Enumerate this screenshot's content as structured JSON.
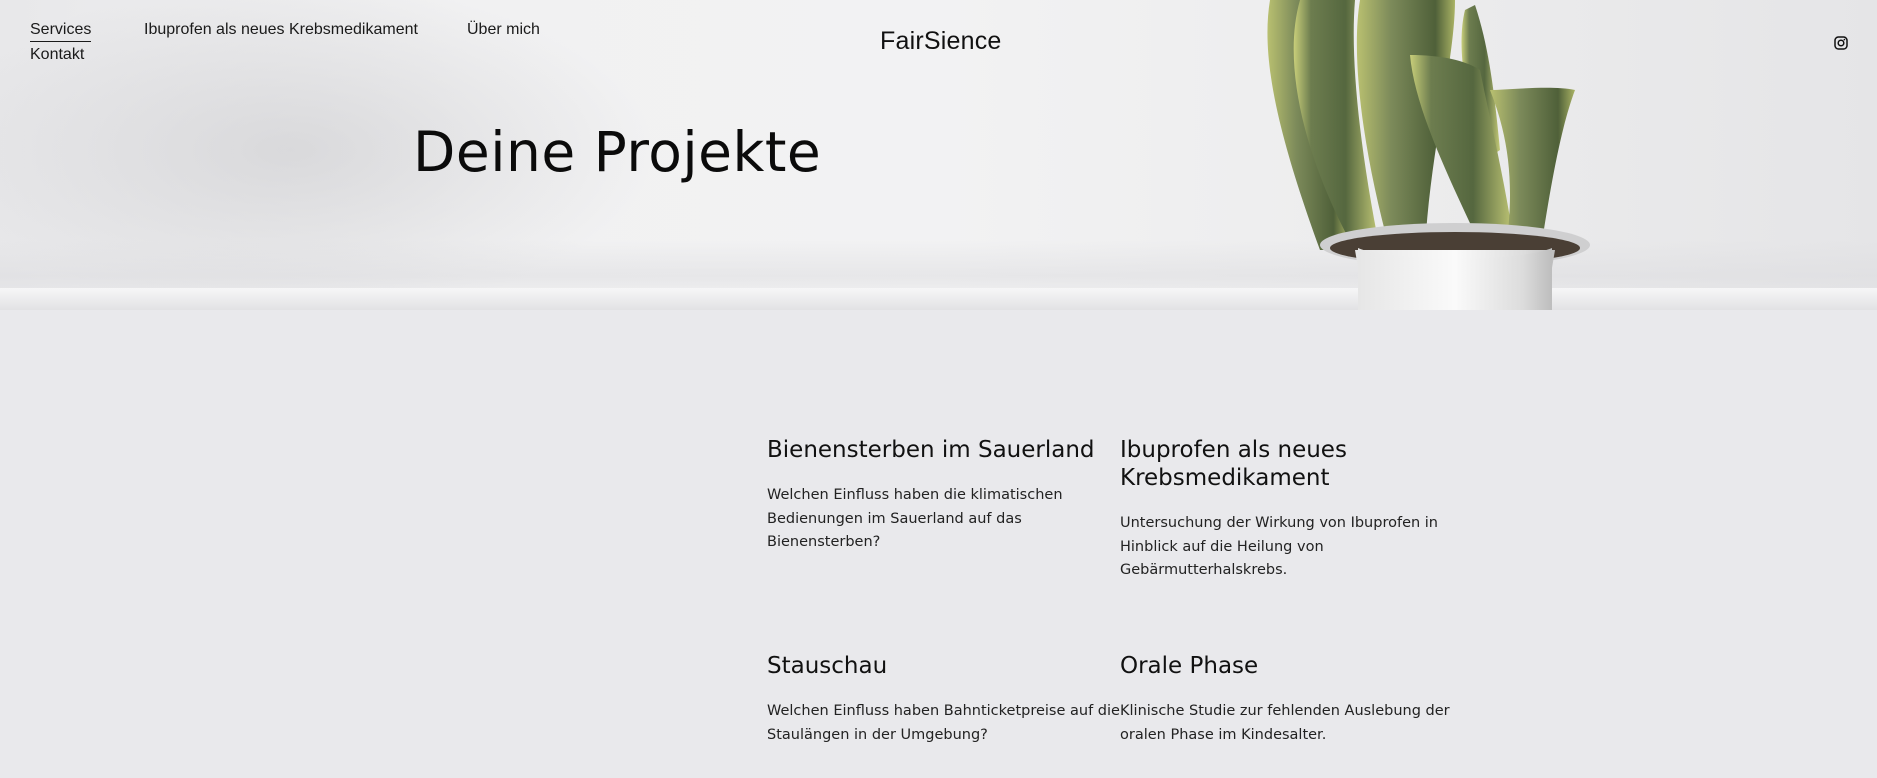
{
  "nav": {
    "items": [
      {
        "label": "Services",
        "active": true
      },
      {
        "label": "Ibuprofen als neues Krebsmedikament",
        "active": false
      },
      {
        "label": "Über mich",
        "active": false
      },
      {
        "label": "Kontakt",
        "active": false
      }
    ]
  },
  "brand": {
    "name": "FairSience"
  },
  "social": {
    "icon": "instagram-icon"
  },
  "hero": {
    "title": "Deine Projekte"
  },
  "projects": [
    {
      "title": "Bienensterben im Sauerland",
      "description": "Welchen Einfluss haben die klimatischen Bedienungen im Sauerland auf das Bienensterben?"
    },
    {
      "title": "Ibuprofen als neues Krebsmedikament",
      "description": "Untersuchung der Wirkung von Ibuprofen in Hinblick auf die Heilung von Gebärmutterhalskrebs."
    },
    {
      "title": "Stauschau",
      "description": "Welchen Einfluss haben Bahnticketpreise auf die Staulängen in der Umgebung?"
    },
    {
      "title": "Orale Phase",
      "description": "Klinische Studie zur fehlenden Auslebung der oralen Phase im Kindesalter."
    }
  ],
  "colors": {
    "background": "#e9e9ec",
    "text": "#111111",
    "plant_leaf": "#5f7046",
    "plant_edge": "#c9cf7a"
  }
}
